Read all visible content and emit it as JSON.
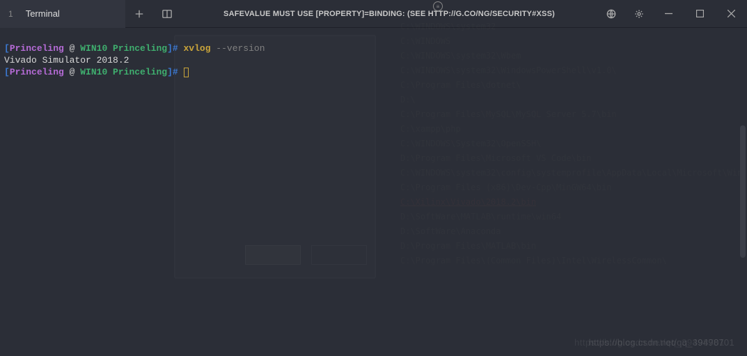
{
  "tab": {
    "index": "1",
    "label": "Terminal"
  },
  "title": "SAFEVALUE MUST USE [PROPERTY]=BINDING:    (SEE HTTP://G.CO/NG/SECURITY#XSS)",
  "prompt": {
    "open": "[",
    "close": "]#",
    "user": "Princeling",
    "at": " @ ",
    "host": "WIN10 Princeling"
  },
  "line1_cmd": "xvlog",
  "line1_arg": " --version",
  "line2_out": "Vivado Simulator 2018.2",
  "ghost_paths": [
    "C:\\WINDOWS\\system32",
    "C:\\WINDOWS",
    "C:\\WINDOWS\\system32\\Wbem",
    "C:\\WINDOWS\\system32\\WindowsPowerShell\\v1.0\\",
    "C:\\Program Files\\dotnet\\",
    "D:\\",
    "C:\\Program Files\\MySQL\\MySQL Server 5.7\\bin",
    "C:\\xampp\\php",
    "C:\\WINDOWS\\System32\\OpenSSH\\",
    "D:\\Program Files\\Microsoft VS Code\\bin",
    "C:\\WINDOWS\\system32\\config\\systemprofile\\AppData\\Local\\Microsoft\\Wind...",
    "C:\\Program Files (x86)\\Dev-Cpp\\MinGW64\\bin",
    "C:\\Xilinx\\Vivado\\2018.2\\bin",
    "D:\\SoftWare\\MATLAB\\runtime\\win64",
    "D:\\SoftWare\\Anaconda",
    "D:\\Program Files\\MATLAB\\bin",
    "C:\\Program Files\\(Common Files)\\Intel\\WirelessCommon\\"
  ],
  "ghost_highlight_index": 12,
  "watermark": "https://blog.csdn.net/qq_39498701",
  "badge": "≡"
}
